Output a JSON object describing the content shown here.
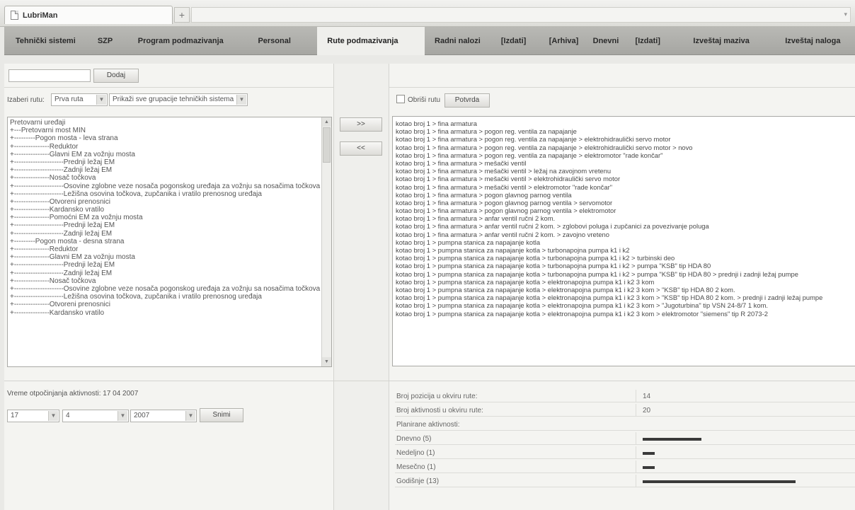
{
  "browser": {
    "tab_title": "LubriMan"
  },
  "nav": [
    {
      "label": "Tehnički sistemi",
      "active": false
    },
    {
      "label": "SZP",
      "active": false
    },
    {
      "label": "Program podmazivanja",
      "active": false
    },
    {
      "label": "Personal",
      "active": false
    },
    {
      "label": "Rute podmazivanja",
      "active": true
    },
    {
      "label": "Radni nalozi",
      "active": false
    },
    {
      "label": "[Izdati]",
      "active": false
    },
    {
      "label": "[Arhiva]",
      "active": false
    },
    {
      "label": "Dnevni",
      "active": false
    },
    {
      "label": "[Izdati]",
      "active": false
    },
    {
      "label": "Izveštaj maziva",
      "active": false
    },
    {
      "label": "Izveštaj naloga",
      "active": false
    }
  ],
  "left": {
    "new_route_value": "",
    "add_button": "Dodaj",
    "choose_route_label": "Izaberi rutu:",
    "route_select": "Prva ruta",
    "group_select": "Prikaži sve grupacije tehničkih sistema",
    "tree": [
      "Pretovarni uređaji",
      "+---Pretovarni most MIN",
      "+---------Pogon mosta - leva strana",
      "+---------------Reduktor",
      "+---------------Glavni EM za vožnju mosta",
      "+---------------------Prednji ležaj EM",
      "+---------------------Zadnji ležaj EM",
      "+---------------Nosač točkova",
      "+---------------------Osovine zglobne veze nosača pogonskog uređaja za vožnju sa nosačima točkova",
      "+---------------------Ležišna osovina točkova, zupčanika i vratilo prenosnog uređaja",
      "+---------------Otvoreni prenosnici",
      "+---------------Kardansko vratilo",
      "+---------------Pomoćni EM za vožnju mosta",
      "+---------------------Prednji ležaj EM",
      "+---------------------Zadnji ležaj EM",
      "+---------Pogon mosta - desna strana",
      "+---------------Reduktor",
      "+---------------Glavni EM za vožnju mosta",
      "+---------------------Prednji ležaj EM",
      "+---------------------Zadnji ležaj EM",
      "+---------------Nosač točkova",
      "+---------------------Osovine zglobne veze nosača pogonskog uređaja za vožnju sa nosačima točkova",
      "+---------------------Ležišna osovina točkova, zupčanika i vratilo prenosnog uređaja",
      "+---------------Otvoreni prenosnici",
      "+---------------Kardansko vratilo"
    ],
    "start_date_label": "Vreme otpočinjanja aktivnosti: 17 04 2007",
    "day_select": "17",
    "month_select": "4",
    "year_select": "2007",
    "save_button": "Snimi"
  },
  "mid": {
    "move_right": ">>",
    "move_left": "<<"
  },
  "right": {
    "delete_route_label": "Obriši rutu",
    "confirm_button": "Potvrda",
    "routes": [
      "kotao broj 1 > fina armatura",
      "kotao broj 1 > fina armatura > pogon reg. ventila za napajanje",
      "kotao broj 1 > fina armatura > pogon reg. ventila za napajanje > elektrohidraulički servo motor",
      "kotao broj 1 > fina armatura > pogon reg. ventila za napajanje > elektrohidraulički servo motor > novo",
      "kotao broj 1 > fina armatura > pogon reg. ventila za napajanje > elektromotor \"rade končar\"",
      "kotao broj 1 > fina armatura > mešački ventil",
      "kotao broj 1 > fina armatura > mešački ventil > ležaj na zavojnom vretenu",
      "kotao broj 1 > fina armatura > mešački ventil > elektrohidraulički servo motor",
      "kotao broj 1 > fina armatura > mešački ventil > elektromotor \"rade končar\"",
      "kotao broj 1 > fina armatura > pogon glavnog parnog ventila",
      "kotao broj 1 > fina armatura > pogon glavnog parnog ventila > servomotor",
      "kotao broj 1 > fina armatura > pogon glavnog parnog ventila > elektromotor",
      "kotao broj 1 > fina armatura > anfar ventil ručni 2 kom.",
      "kotao broj 1 > fina armatura > anfar ventil ručni 2 kom. > zglobovi poluga i zupčanici za povezivanje poluga",
      "kotao broj 1 > fina armatura > anfar ventil ručni 2 kom. > zavojno vreteno",
      "kotao broj 1 > pumpna stanica za napajanje kotla",
      "kotao broj 1 > pumpna stanica za napajanje kotla > turbonapojna pumpa k1 i k2",
      "kotao broj 1 > pumpna stanica za napajanje kotla > turbonapojna pumpa k1 i k2 > turbinski deo",
      "kotao broj 1 > pumpna stanica za napajanje kotla > turbonapojna pumpa k1 i k2 > pumpa \"KSB\" tip HDA 80",
      "kotao broj 1 > pumpna stanica za napajanje kotla > turbonapojna pumpa k1 i k2 > pumpa \"KSB\" tip HDA 80 > prednji i zadnji ležaj pumpe",
      "kotao broj 1 > pumpna stanica za napajanje kotla > elektronapojna pumpa k1 i k2 3 kom",
      "kotao broj 1 > pumpna stanica za napajanje kotla > elektronapojna pumpa k1 i k2 3 kom > \"KSB\" tip HDA 80 2 kom.",
      "kotao broj 1 > pumpna stanica za napajanje kotla > elektronapojna pumpa k1 i k2 3 kom > \"KSB\" tip HDA 80 2 kom. > prednji i zadnji ležaj pumpe",
      "kotao broj 1 > pumpna stanica za napajanje kotla > elektronapojna pumpa k1 i k2 3 kom > \"Jugoturbina\" tip VSN 24-8/7 1 kom.",
      "kotao broj 1 > pumpna stanica za napajanje kotla > elektronapojna pumpa k1 i k2 3 kom > elektromotor \"siemens\" tip R 2073-2"
    ],
    "stats": {
      "positions_label": "Broj pozicija u okviru rute:",
      "positions_value": "14",
      "activities_label": "Broj aktivnosti u okviru rute:",
      "activities_value": "20",
      "planned_label": "Planirane aktivnosti:",
      "planned": [
        {
          "label": "Dnevno (5)",
          "count": 5
        },
        {
          "label": "Nedeljno (1)",
          "count": 1
        },
        {
          "label": "Mesečno (1)",
          "count": 1
        },
        {
          "label": "Godišnje (13)",
          "count": 13
        }
      ]
    }
  }
}
